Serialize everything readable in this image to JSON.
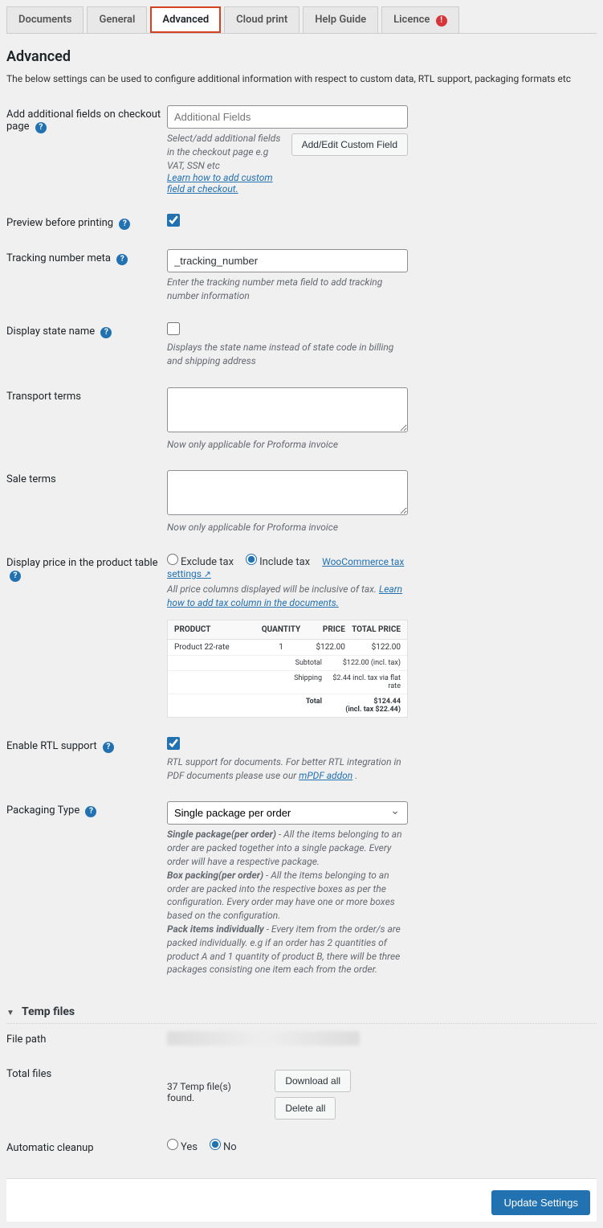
{
  "tabs": {
    "documents": "Documents",
    "general": "General",
    "advanced": "Advanced",
    "cloud_print": "Cloud print",
    "help_guide": "Help Guide",
    "licence": "Licence"
  },
  "heading": "Advanced",
  "intro": "The below settings can be used to configure additional information with respect to custom data, RTL support, packaging formats etc",
  "additional_fields": {
    "label": "Add additional fields on checkout page",
    "placeholder": "Additional Fields",
    "desc": "Select/add additional fields in the checkout page e.g VAT, SSN etc",
    "learn_link": "Learn how to add custom field at checkout.",
    "button": "Add/Edit Custom Field"
  },
  "preview": {
    "label": "Preview before printing",
    "checked": true
  },
  "tracking": {
    "label": "Tracking number meta",
    "value": "_tracking_number",
    "desc": "Enter the tracking number meta field to add tracking number information"
  },
  "state_name": {
    "label": "Display state name",
    "checked": false,
    "desc": "Displays the state name instead of state code in billing and shipping address"
  },
  "transport": {
    "label": "Transport terms",
    "desc": "Now only applicable for Proforma invoice"
  },
  "sale": {
    "label": "Sale terms",
    "desc": "Now only applicable for Proforma invoice"
  },
  "price_table": {
    "label": "Display price in the product table",
    "option_exclude": "Exclude tax",
    "option_include": "Include tax",
    "selected": "include",
    "tax_settings_link": "WooCommerce tax settings",
    "desc_prefix": "All price columns displayed will be inclusive of tax. ",
    "desc_link": "Learn how to add tax column in the documents.",
    "headers": {
      "product": "PRODUCT",
      "qty": "QUANTITY",
      "price": "PRICE",
      "total": "TOTAL PRICE"
    },
    "row": {
      "product": "Product 22-rate",
      "qty": "1",
      "price": "$122.00",
      "total": "$122.00"
    },
    "totals": {
      "subtotal_label": "Subtotal",
      "subtotal_val": "$122.00 (incl. tax)",
      "shipping_label": "Shipping",
      "shipping_val": "$2.44 incl. tax via flat rate",
      "total_label": "Total",
      "total_val": "$124.44",
      "total_sub": "(incl. tax $22.44)"
    }
  },
  "rtl": {
    "label": "Enable RTL support",
    "checked": true,
    "desc_prefix": "RTL support for documents. For better RTL integration in PDF documents please use our ",
    "desc_link": "mPDF addon",
    "desc_suffix": " ."
  },
  "packaging": {
    "label": "Packaging Type",
    "selected": "Single package per order",
    "desc_single_title": "Single package(per order)",
    "desc_single_body": " - All the items belonging to an order are packed together into a single package. Every order will have a respective package.",
    "desc_box_title": "Box packing(per order)",
    "desc_box_body": " - All the items belonging to an order are packed into the respective boxes as per the configuration. Every order may have one or more boxes based on the configuration.",
    "desc_indiv_title": "Pack items individually",
    "desc_indiv_body": " - Every item from the order/s are packed individually. e.g if an order has 2 quantities of product A and 1 quantity of product B, there will be three packages consisting one item each from the order."
  },
  "temp_section": "Temp files",
  "file_path": {
    "label": "File path"
  },
  "total_files": {
    "label": "Total files",
    "value": "37 Temp file(s) found.",
    "download_btn": "Download all",
    "delete_btn": "Delete all"
  },
  "cleanup": {
    "label": "Automatic cleanup",
    "yes": "Yes",
    "no": "No",
    "selected": "no"
  },
  "footer": {
    "update": "Update Settings"
  }
}
